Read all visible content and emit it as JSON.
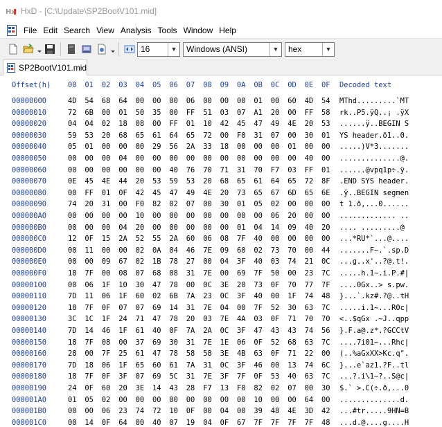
{
  "window": {
    "title": "HxD - [C:\\Update\\SP2BootV101.mid]",
    "app_icon_text": "HxD"
  },
  "menu": [
    "File",
    "Edit",
    "Search",
    "View",
    "Analysis",
    "Tools",
    "Window",
    "Help"
  ],
  "toolbar": {
    "bytes_per_row": "16",
    "charset": "Windows (ANSI)",
    "display_mode": "hex"
  },
  "tabs": [
    {
      "label": "SP2BootV101.mid"
    }
  ],
  "editor": {
    "offset_header": "Offset(h)",
    "column_headers": [
      "00",
      "01",
      "02",
      "03",
      "04",
      "05",
      "06",
      "07",
      "08",
      "09",
      "0A",
      "0B",
      "0C",
      "0D",
      "0E",
      "0F"
    ],
    "decoded_header": "Decoded text",
    "rows": [
      {
        "offset": "00000000",
        "hex": "4D 54 68 64 00 00 00 06 00 00 00 01 00 60 4D 54",
        "text": "MThd.........`MT"
      },
      {
        "offset": "00000010",
        "hex": "72 6B 00 01 50 35 00 FF 51 03 07 A1 20 00 FF 58",
        "text": "rk..P5.ÿQ..¡ .ÿX"
      },
      {
        "offset": "00000020",
        "hex": "04 04 02 18 08 00 FF 01 10 42 45 47 49 4E 20 53",
        "text": "......ÿ..BEGIN S"
      },
      {
        "offset": "00000030",
        "hex": "59 53 20 68 65 61 64 65 72 00 F0 31 07 00 30 01",
        "text": "YS header.ð1..0."
      },
      {
        "offset": "00000040",
        "hex": "05 01 00 00 00 29 56 2A 33 18 00 00 00 01 00 00",
        "text": ".....)V*3......."
      },
      {
        "offset": "00000050",
        "hex": "00 00 00 04 00 00 00 00 00 00 00 00 00 00 40 00",
        "text": "..............@."
      },
      {
        "offset": "00000060",
        "hex": "00 00 00 00 00 00 40 76 70 71 31 70 F7 03 FF 01",
        "text": "......@vpq1p÷.ÿ."
      },
      {
        "offset": "00000070",
        "hex": "0E 45 4E 44 20 53 59 53 20 68 65 61 64 65 72 8F",
        "text": ".END SYS header."
      },
      {
        "offset": "00000080",
        "hex": "00 FF 01 0F 42 45 47 49 4E 20 73 65 67 6D 65 6E",
        "text": ".ÿ..BEGIN segmen"
      },
      {
        "offset": "00000090",
        "hex": "74 20 31 00 F0 82 02 07 00 30 01 05 02 00 00 00",
        "text": "t 1.ð‚...0......"
      },
      {
        "offset": "000000A0",
        "hex": "00 00 00 00 10 00 00 00 00 00 00 00 06 20 00 00",
        "text": "............. .."
      },
      {
        "offset": "000000B0",
        "hex": "00 00 00 04 20 00 00 00 00 00 01 04 14 09 40 20",
        "text": ".... .........@ "
      },
      {
        "offset": "000000C0",
        "hex": "12 0F 15 2A 52 55 2A 60 06 08 7F 40 00 00 00 00",
        "text": "...*RU*`...@...."
      },
      {
        "offset": "000000D0",
        "hex": "00 11 00 00 02 0A 04 46 7E 09 60 02 73 70 00 44",
        "text": ".......F~.`.sp.D"
      },
      {
        "offset": "000000E0",
        "hex": "00 00 09 67 02 1B 78 27 00 04 3F 40 03 74 21 0C",
        "text": "...g..x'..?@.t!."
      },
      {
        "offset": "000000F0",
        "hex": "18 7F 00 08 07 68 08 31 7E 00 69 7F 50 00 23 7C",
        "text": ".....h.1~.i.P.#|"
      },
      {
        "offset": "00000100",
        "hex": "00 06 1F 10 30 47 78 00 0C 3E 20 73 0F 70 77 7F",
        "text": "....0Gx..> s.pw."
      },
      {
        "offset": "00000110",
        "hex": "7D 11 06 1F 60 02 6B 7A 23 0C 3F 40 00 1F 74 48",
        "text": "}...`.kz#.?@..tH"
      },
      {
        "offset": "00000120",
        "hex": "18 7F 0F 07 07 69 14 31 7E 04 00 7F 52 30 63 7C",
        "text": ".....i.1~...R0c|"
      },
      {
        "offset": "00000130",
        "hex": "3C 1C 1F 24 71 47 78 20 03 7E 4A 03 0F 71 70 70",
        "text": "<..$qGx .~J..qpp"
      },
      {
        "offset": "00000140",
        "hex": "7D 14 46 1F 61 40 0F 7A 2A 0C 3F 47 43 43 74 56",
        "text": "}.F.a@.z*.?GCCtV"
      },
      {
        "offset": "00000150",
        "hex": "18 7F 08 00 37 69 30 31 7E 1E 06 0F 52 68 63 7C",
        "text": "....7i01~...Rhc|"
      },
      {
        "offset": "00000160",
        "hex": "28 00 7F 25 61 47 78 58 58 3E 4B 63 0F 71 22 00",
        "text": "(..%aGxXX>Kc.q\"."
      },
      {
        "offset": "00000170",
        "hex": "7D 18 06 1F 65 60 61 7A 31 0C 3F 46 00 13 74 6C",
        "text": "}...e`az1.?F..tl"
      },
      {
        "offset": "00000180",
        "hex": "18 7F 0F 3F 07 69 5C 31 7E 3F 7F 0F 53 40 63 7C",
        "text": "...?.i\\1~?..S@c|"
      },
      {
        "offset": "00000190",
        "hex": "24 0F 60 20 3E 14 43 28 F7 13 F0 82 02 07 00 30",
        "text": "$.` >.C(÷.ð‚...0"
      },
      {
        "offset": "000001A0",
        "hex": "01 05 02 00 00 00 00 00 00 00 00 10 00 00 64 00",
        "text": "..............d."
      },
      {
        "offset": "000001B0",
        "hex": "00 00 06 23 74 72 10 0F 00 04 00 39 48 4E 3D 42",
        "text": "...#tr.....9HN=B"
      },
      {
        "offset": "000001C0",
        "hex": "00 14 0F 64 00 40 07 19 04 0F 67 7F 7F 7F 7F 48",
        "text": "...d.@....g....H"
      }
    ]
  }
}
